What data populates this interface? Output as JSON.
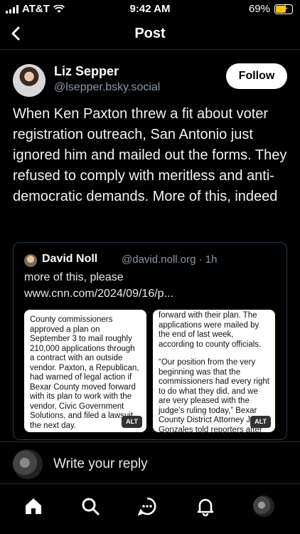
{
  "status_bar": {
    "carrier": "AT&T",
    "time": "9:42 AM",
    "battery": "69%",
    "battery_level": 0.69
  },
  "header": {
    "title": "Post",
    "back_icon": "chevron-left-icon"
  },
  "post": {
    "author_name": "Liz Sepper",
    "author_handle": "@lsepper.bsky.social",
    "follow_label": "Follow",
    "text": "When Ken Paxton threw a fit about voter registration outreach, San Antonio just ignored him and mailed out the forms. They refused to comply with meritless and anti-democratic demands. More of this, indeed"
  },
  "quote": {
    "author_name": "David Noll",
    "meta": "@david.noll.org · 1h",
    "text": "more of this, please",
    "link": "www.cnn.com/2024/09/16/p...",
    "image1_text": "County commissioners approved a plan on September 3 to mail roughly 210,000 applications through a contract with an outside vendor. Paxton, a Republican, had warned of legal action if Bexar County moved forward with its plan to work with the vendor, Civic Government Solutions, and filed a lawsuit the next day.",
    "image2_text_a": "forward with their plan. The applications were mailed by the end of last week, according to county officials.",
    "image2_text_b": "“Our position from the very beginning was that the commissioners had every right to do what they did, and we are very pleased with the judge’s ruling today,” Bexar County District Attorney Joe Gonzales told reporters after",
    "alt_label": "ALT"
  },
  "reply": {
    "placeholder": "Write your reply"
  },
  "nav": {
    "items": [
      "home-icon",
      "search-icon",
      "chat-icon",
      "bell-icon",
      "profile-avatar"
    ]
  }
}
